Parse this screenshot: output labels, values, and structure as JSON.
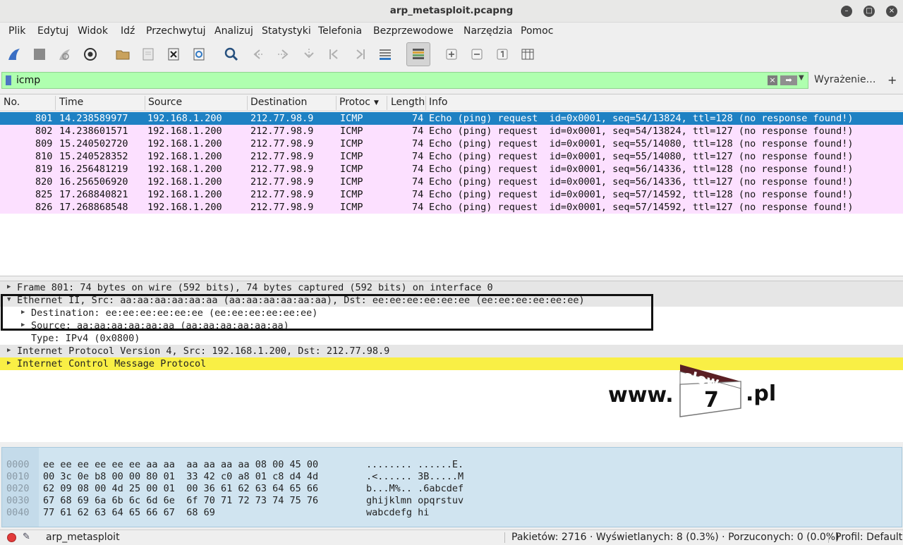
{
  "window": {
    "title": "arp_metasploit.pcapng"
  },
  "menu": [
    "Plik",
    "Edytuj",
    "Widok",
    "Idź",
    "Przechwytuj",
    "Analizuj",
    "Statystyki",
    "Telefonia",
    "Bezprzewodowe",
    "Narzędzia",
    "Pomoc"
  ],
  "toolbar": {
    "icons": [
      "shark-fin-start-icon",
      "stop-icon",
      "restart-icon",
      "capture-options-icon",
      "open-folder-icon",
      "save-icon",
      "close-file-icon",
      "reload-icon",
      "find-icon",
      "go-back-icon",
      "go-forward-icon",
      "go-to-packet-icon",
      "first-packet-icon",
      "last-packet-icon",
      "autoscroll-icon",
      "colorize-icon",
      "zoom-in-icon",
      "zoom-out-icon",
      "normal-size-icon",
      "resize-columns-icon"
    ]
  },
  "filter": {
    "value": "icmp",
    "expression_label": "Wyrażenie…",
    "plus": "+"
  },
  "packet_list": {
    "columns": [
      "No.",
      "Time",
      "Source",
      "Destination",
      "Protoc",
      "Length",
      "Info"
    ],
    "rows": [
      {
        "no": "801",
        "time": "14.238589977",
        "src": "192.168.1.200",
        "dst": "212.77.98.9",
        "proto": "ICMP",
        "len": "74",
        "info": "Echo (ping) request  id=0x0001, seq=54/13824, ttl=128 (no response found!)"
      },
      {
        "no": "802",
        "time": "14.238601571",
        "src": "192.168.1.200",
        "dst": "212.77.98.9",
        "proto": "ICMP",
        "len": "74",
        "info": "Echo (ping) request  id=0x0001, seq=54/13824, ttl=127 (no response found!)"
      },
      {
        "no": "809",
        "time": "15.240502720",
        "src": "192.168.1.200",
        "dst": "212.77.98.9",
        "proto": "ICMP",
        "len": "74",
        "info": "Echo (ping) request  id=0x0001, seq=55/14080, ttl=128 (no response found!)"
      },
      {
        "no": "810",
        "time": "15.240528352",
        "src": "192.168.1.200",
        "dst": "212.77.98.9",
        "proto": "ICMP",
        "len": "74",
        "info": "Echo (ping) request  id=0x0001, seq=55/14080, ttl=127 (no response found!)"
      },
      {
        "no": "819",
        "time": "16.256481219",
        "src": "192.168.1.200",
        "dst": "212.77.98.9",
        "proto": "ICMP",
        "len": "74",
        "info": "Echo (ping) request  id=0x0001, seq=56/14336, ttl=128 (no response found!)"
      },
      {
        "no": "820",
        "time": "16.256506920",
        "src": "192.168.1.200",
        "dst": "212.77.98.9",
        "proto": "ICMP",
        "len": "74",
        "info": "Echo (ping) request  id=0x0001, seq=56/14336, ttl=127 (no response found!)"
      },
      {
        "no": "825",
        "time": "17.268840821",
        "src": "192.168.1.200",
        "dst": "212.77.98.9",
        "proto": "ICMP",
        "len": "74",
        "info": "Echo (ping) request  id=0x0001, seq=57/14592, ttl=128 (no response found!)"
      },
      {
        "no": "826",
        "time": "17.268868548",
        "src": "192.168.1.200",
        "dst": "212.77.98.9",
        "proto": "ICMP",
        "len": "74",
        "info": "Echo (ping) request  id=0x0001, seq=57/14592, ttl=127 (no response found!)"
      }
    ]
  },
  "details": {
    "rows": [
      {
        "text": "Frame 801: 74 bytes on wire (592 bits), 74 bytes captured (592 bits) on interface 0",
        "arrow": "▶"
      },
      {
        "text": "Ethernet II, Src: aa:aa:aa:aa:aa:aa (aa:aa:aa:aa:aa:aa), Dst: ee:ee:ee:ee:ee:ee (ee:ee:ee:ee:ee:ee)",
        "arrow": "▼"
      },
      {
        "text": "Destination: ee:ee:ee:ee:ee:ee (ee:ee:ee:ee:ee:ee)",
        "arrow": "▶"
      },
      {
        "text": "Source: aa:aa:aa:aa:aa:aa (aa:aa:aa:aa:aa:aa)",
        "arrow": "▶"
      },
      {
        "text": "Type: IPv4 (0x0800)",
        "arrow": ""
      },
      {
        "text": "Internet Protocol Version 4, Src: 192.168.1.200, Dst: 212.77.98.9",
        "arrow": "▶"
      },
      {
        "text": "Internet Control Message Protocol",
        "arrow": "▶"
      }
    ]
  },
  "watermark": {
    "prefix": "www.",
    "brand_top": "slow",
    "brand_num": "7",
    "suffix": ".pl"
  },
  "hex": {
    "rows": [
      {
        "offset": "0000",
        "bytes": "ee ee ee ee ee ee aa aa  aa aa aa aa 08 00 45 00",
        "ascii": "........ ......E."
      },
      {
        "offset": "0010",
        "bytes": "00 3c 0e b8 00 00 80 01  33 42 c0 a8 01 c8 d4 4d",
        "ascii": ".<...... 3B.....M"
      },
      {
        "offset": "0020",
        "bytes": "62 09 08 00 4d 25 00 01  00 36 61 62 63 64 65 66",
        "ascii": "b...M%.. .6abcdef"
      },
      {
        "offset": "0030",
        "bytes": "67 68 69 6a 6b 6c 6d 6e  6f 70 71 72 73 74 75 76",
        "ascii": "ghijklmn opqrstuv"
      },
      {
        "offset": "0040",
        "bytes": "77 61 62 63 64 65 66 67  68 69",
        "ascii": "wabcdefg hi"
      }
    ]
  },
  "status": {
    "file": "arp_metasploit",
    "stats": "Pakietów: 2716 · Wyświetlanych: 8 (0.3%) · Porzuconych: 0 (0.0%)",
    "profile": "Profil: Default"
  },
  "colors": {
    "selected_row": "#1e81c3",
    "icmp_row": "#fce0ff",
    "filter_ok": "#afffaf",
    "icmp_detail": "#f9ef45",
    "hex_bg": "#d0e4f0"
  }
}
